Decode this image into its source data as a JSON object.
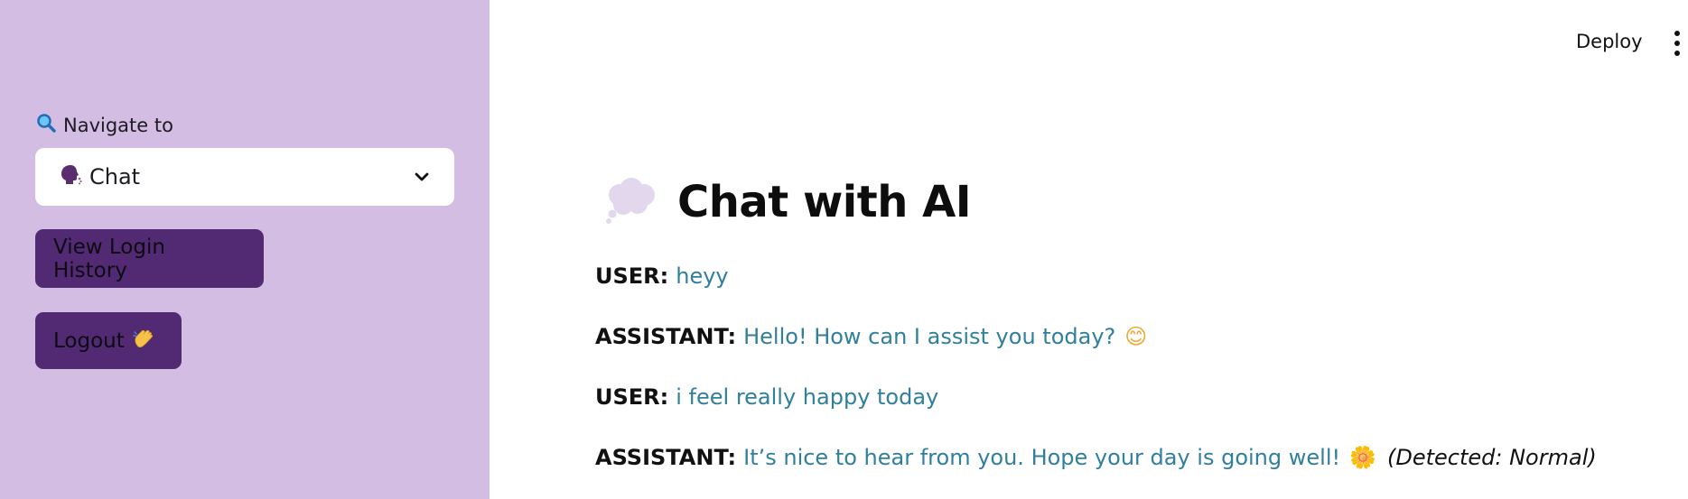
{
  "sidebar": {
    "nav_label": "Navigate to",
    "nav_icon": "magnifier-icon",
    "select": {
      "icon": "speaking-head-icon",
      "value": "Chat"
    },
    "view_login_history_label": "View Login History",
    "logout_label": "Logout",
    "logout_icon": "waving-hand-icon",
    "background_color": "#d4bde2",
    "button_color": "#512a73"
  },
  "header": {
    "deploy_label": "Deploy"
  },
  "main": {
    "title": "Chat with AI",
    "title_icon": "thought-balloon-icon",
    "messages": [
      {
        "role": "USER:",
        "text": "heyy",
        "emoji": "",
        "note": ""
      },
      {
        "role": "ASSISTANT:",
        "text": "Hello! How can I assist you today?",
        "emoji": "😊",
        "note": ""
      },
      {
        "role": "USER:",
        "text": "i feel really happy today",
        "emoji": "",
        "note": ""
      },
      {
        "role": "ASSISTANT:",
        "text": "It’s nice to hear from you. Hope your day is going well!",
        "emoji": "🌼",
        "note": "(Detected: Normal)"
      }
    ],
    "message_text_color": "#2f7f9d"
  }
}
